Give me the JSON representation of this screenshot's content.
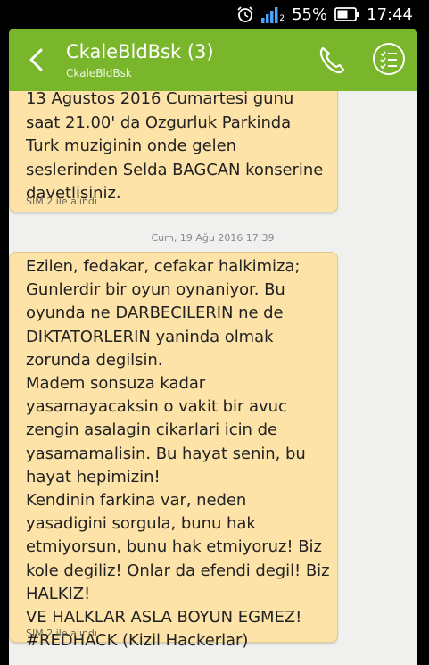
{
  "status_bar": {
    "battery_percent": "55%",
    "time": "17:44",
    "signal_sim": "2"
  },
  "header": {
    "title": "CkaleBldBsk (3)",
    "subtitle": "CkaleBldBsk"
  },
  "colors": {
    "appbar": "#79b62b",
    "bubble": "#fde3a8",
    "background": "#f0f0ee"
  },
  "icons": {
    "back": "back-arrow-icon",
    "call": "phone-icon",
    "menu": "list-menu-icon",
    "alarm": "alarm-clock-icon",
    "signal": "signal-bars-icon",
    "battery": "battery-icon"
  },
  "messages": [
    {
      "text": "13 Agustos 2016 Cumartesi gunu\nsaat 21.00' da Ozgurluk Parkinda\nTurk muziginin onde gelen\nseslerinden Selda BAGCAN konserine\ndavetlisiniz.",
      "sim_label": "SIM 2 ile alındı"
    },
    {
      "timestamp": "Cum, 19 Ağu 2016 17:39",
      "text": "Ezilen, fedakar, cefakar halkimiza;\nGunlerdir bir oyun oynaniyor. Bu\noyunda ne DARBECILERIN ne de\nDIKTATORLERIN yaninda olmak\nzorunda degilsin.\nMadem sonsuza kadar\nyasamayacaksin o vakit bir avuc\nzengin asalagin cikarlari icin de\nyasamamalisin. Bu hayat senin, bu\nhayat hepimizin!\nKendinin farkina var, neden\nyasadigini sorgula, bunu hak\netmiyorsun, bunu hak etmiyoruz! Biz\nkole degiliz! Onlar da efendi degil! Biz\nHALKIZ!\nVE HALKLAR ASLA BOYUN EGMEZ!\n#REDHACK (Kizil Hackerlar)",
      "sim_label": "SIM 2 ile alındı"
    }
  ]
}
